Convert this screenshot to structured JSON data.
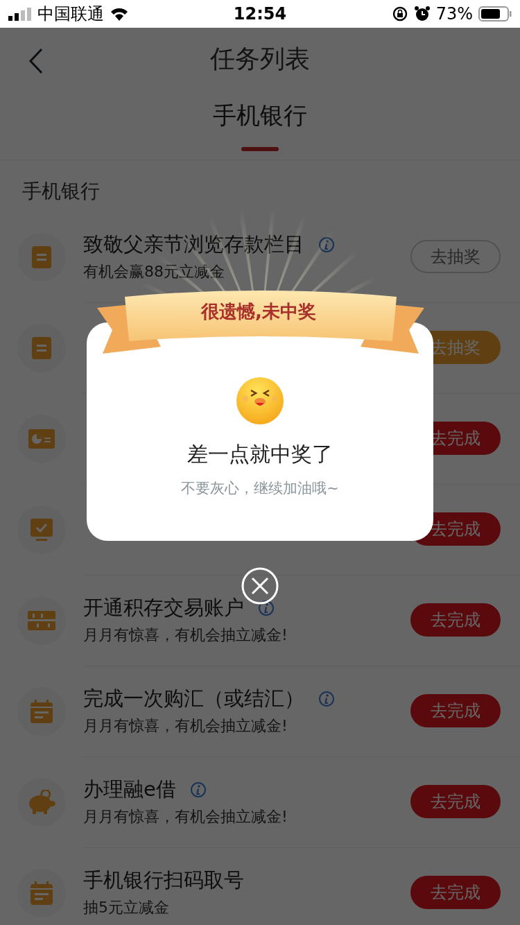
{
  "status_bar": {
    "carrier": "中国联通",
    "time": "12:54",
    "battery": "73%"
  },
  "nav": {
    "title": "任务列表"
  },
  "tabs": [
    {
      "label": "手机银行",
      "selected": true
    }
  ],
  "section": {
    "title": "手机银行"
  },
  "tasks": [
    {
      "kind": "doc",
      "title": "致敬父亲节浏览存款栏目",
      "info": true,
      "subtitle": "有机会赢88元立减金",
      "button": {
        "label": "去抽奖",
        "kind": "outline"
      }
    },
    {
      "kind": "doc",
      "button": {
        "label": "去抽奖",
        "kind": "orange"
      }
    },
    {
      "kind": "chart",
      "button": {
        "label": "去完成",
        "kind": "red"
      }
    },
    {
      "kind": "monitor",
      "button": {
        "label": "去完成",
        "kind": "red"
      }
    },
    {
      "kind": "abacus",
      "title": "开通积存交易账户",
      "info": true,
      "subtitle": "月月有惊喜，有机会抽立减金!",
      "button": {
        "label": "去完成",
        "kind": "red"
      }
    },
    {
      "kind": "calendar",
      "title": "完成一次购汇（或结汇）",
      "info": true,
      "subtitle": "月月有惊喜，有机会抽立减金!",
      "button": {
        "label": "去完成",
        "kind": "red"
      }
    },
    {
      "kind": "piggy",
      "title": "办理融e借",
      "info": true,
      "subtitle": "月月有惊喜，有机会抽立减金!",
      "button": {
        "label": "去完成",
        "kind": "red"
      }
    },
    {
      "kind": "calendar",
      "title": "手机银行扫码取号",
      "info": false,
      "subtitle": "抽5元立减金",
      "button": {
        "label": "去完成",
        "kind": "red"
      }
    }
  ],
  "dialog": {
    "banner": "很遗憾,未中奖",
    "title": "差一点就中奖了",
    "message": "不要灰心，继续加油哦~"
  }
}
